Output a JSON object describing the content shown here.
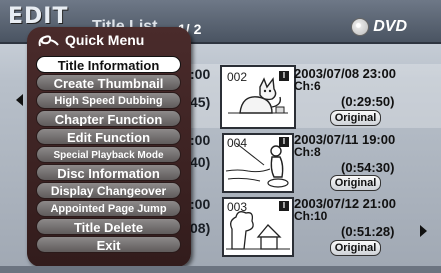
{
  "header": {
    "logo": "EDIT",
    "title": "Title List",
    "page_indicator": "1/ 2",
    "disc_type": "DVD"
  },
  "titles": [
    {
      "number": "002",
      "time_fragment": ":00",
      "duration_fragment": "45)",
      "date": "2003/07/08 23:00",
      "channel": "Ch:6",
      "duration": "(0:29:50)",
      "badge": "Original"
    },
    {
      "number": "004",
      "time_fragment": ":00",
      "duration_fragment": "40)",
      "date": "2003/07/11 19:00",
      "channel": "Ch:8",
      "duration": "(0:54:30)",
      "badge": "Original"
    },
    {
      "number": "003",
      "time_fragment": ":00",
      "duration_fragment": "08)",
      "date": "2003/07/12 21:00",
      "channel": "Ch:10",
      "duration": "(0:51:28)",
      "badge": "Original"
    }
  ],
  "quick_menu": {
    "title": "Quick Menu",
    "items": [
      {
        "label": "Title Information",
        "selected": true
      },
      {
        "label": "Create Thumbnail",
        "selected": false
      },
      {
        "label": "High Speed Dubbing",
        "selected": false
      },
      {
        "label": "Chapter Function",
        "selected": false
      },
      {
        "label": "Edit Function",
        "selected": false
      },
      {
        "label": "Special Playback Mode",
        "selected": false
      },
      {
        "label": "Disc Information",
        "selected": false
      },
      {
        "label": "Display Changeover",
        "selected": false
      },
      {
        "label": "Appointed Page Jump",
        "selected": false
      },
      {
        "label": "Title Delete",
        "selected": false
      },
      {
        "label": "Exit",
        "selected": false
      }
    ]
  }
}
